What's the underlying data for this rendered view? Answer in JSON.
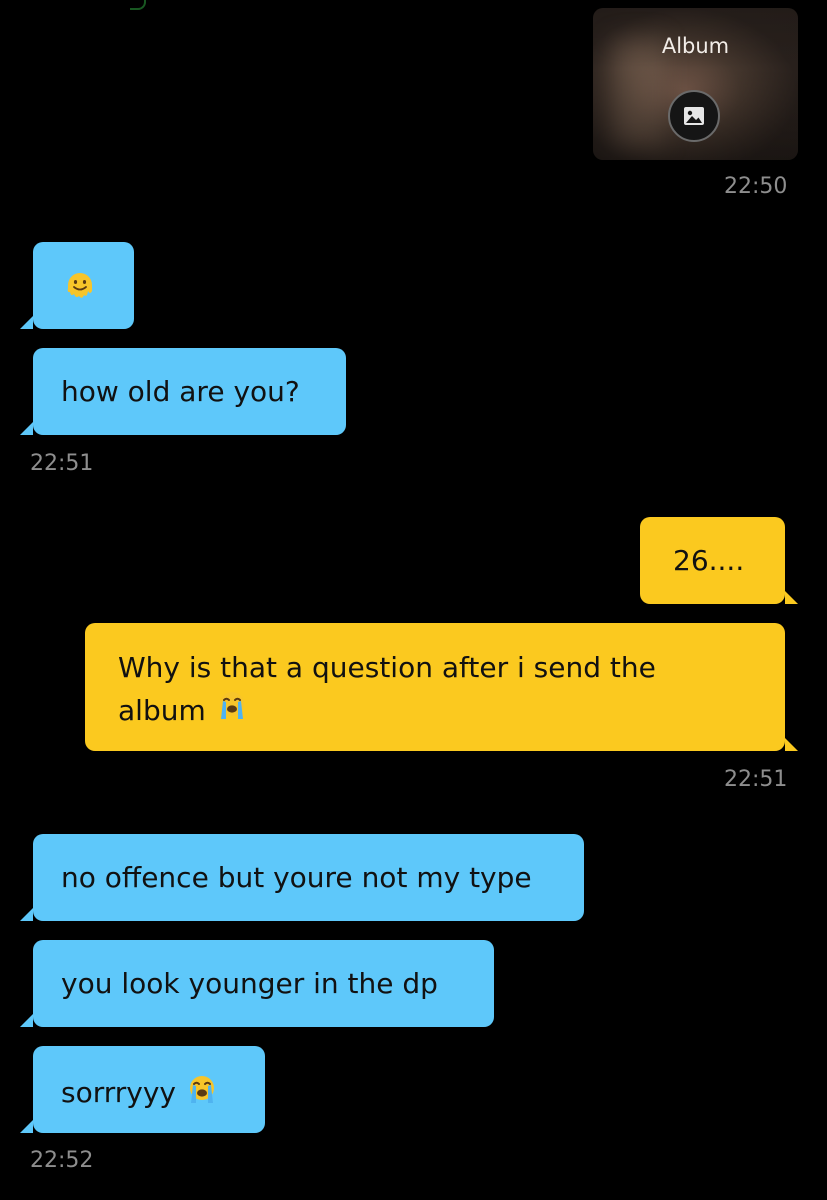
{
  "album": {
    "label": "Album",
    "icon": "image-icon",
    "timestamp": "22:50"
  },
  "incoming_group_1": {
    "emoji_message": "melting-face-emoji",
    "message_2": "how old are you?",
    "timestamp": "22:51"
  },
  "outgoing_group": {
    "message_1": "26....",
    "message_2_line_1": "Why is that a question after i send the",
    "message_2_line_2": "album",
    "message_2_emoji": "loudly-crying-face-emoji",
    "timestamp": "22:51"
  },
  "incoming_group_2": {
    "message_1": "no offence but youre not my type",
    "message_2": "you look younger in the dp",
    "message_3": "sorrryyy",
    "message_3_emoji": "loudly-crying-face-emoji",
    "timestamp": "22:52"
  },
  "colors": {
    "background": "#000000",
    "incoming_bubble": "#5ec8fa",
    "outgoing_bubble": "#fbc91f",
    "timestamp_text": "#8e8e8e"
  }
}
